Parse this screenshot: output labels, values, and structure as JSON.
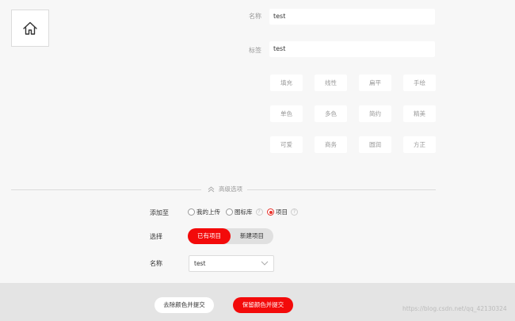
{
  "form": {
    "name_label": "名称",
    "name_value": "test",
    "tag_label": "标签",
    "tag_value": "test"
  },
  "tags": [
    [
      "填充",
      "线性",
      "扁平",
      "手绘"
    ],
    [
      "单色",
      "多色",
      "简约",
      "精美"
    ],
    [
      "可爱",
      "商务",
      "圆润",
      "方正"
    ]
  ],
  "advanced": {
    "label": "高级选项"
  },
  "add_to": {
    "label": "添加至",
    "options": [
      "我的上传",
      "图标库",
      "项目"
    ],
    "help_glyph": "?",
    "selected": "项目"
  },
  "select_row": {
    "label": "选择",
    "existing": "已有项目",
    "new": "新建项目"
  },
  "project_name": {
    "label": "名称",
    "value": "test"
  },
  "footer": {
    "remove_color_submit": "去除颜色并提交",
    "keep_color_submit": "保留颜色并提交"
  },
  "watermark": "https://blog.csdn.net/qq_42130324",
  "colors": {
    "accent": "#f30a0a",
    "radio_selected": "#e8322b"
  },
  "icons": {
    "preview": "home-icon",
    "advanced": "double-chevron-up-icon",
    "select": "chevron-down-icon"
  }
}
